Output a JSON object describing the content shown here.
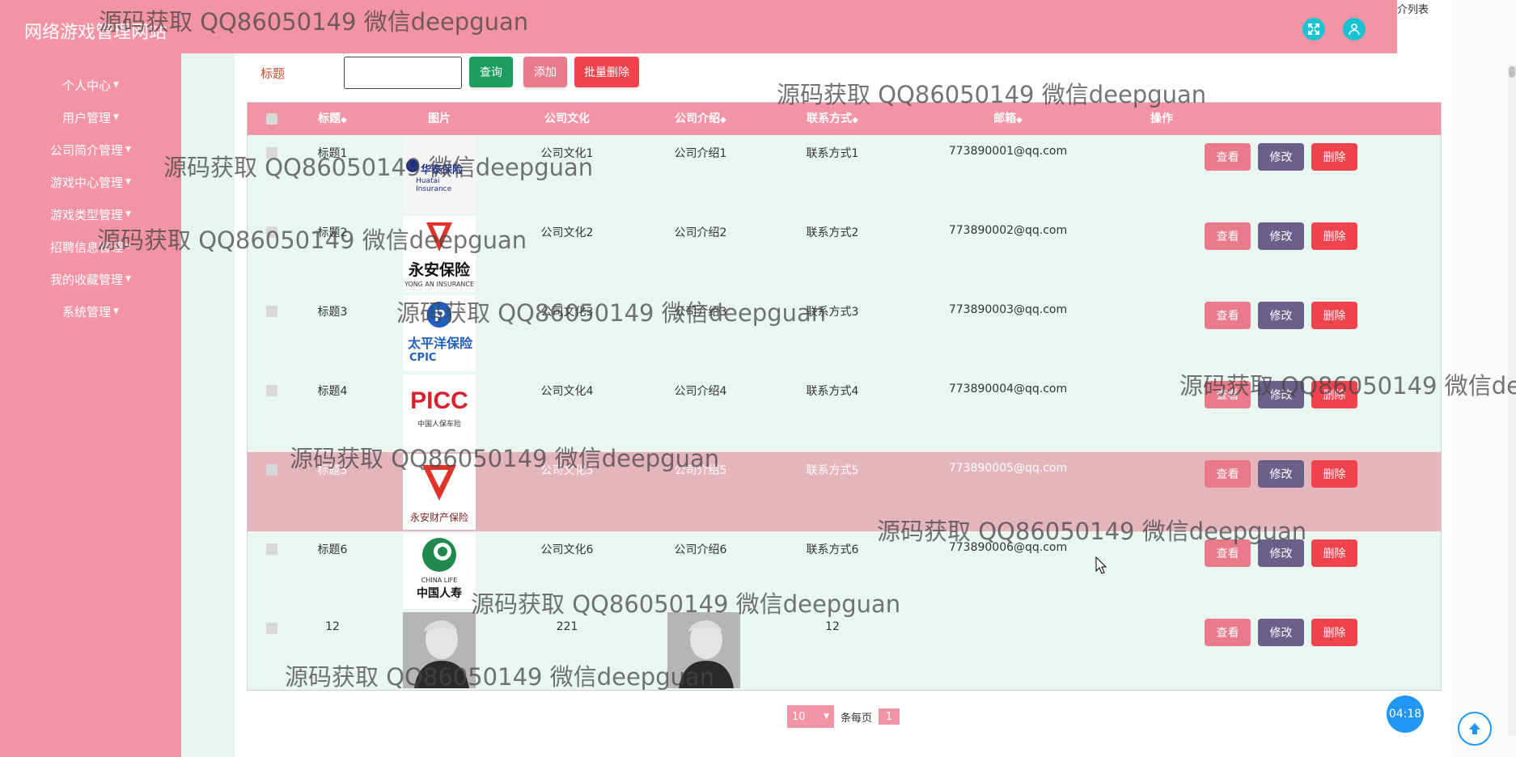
{
  "header": {
    "site_title": "网络游戏管理网站",
    "tab_label": "介列表"
  },
  "sidebar": {
    "items": [
      {
        "label": "个人中心"
      },
      {
        "label": "用户管理"
      },
      {
        "label": "公司简介管理"
      },
      {
        "label": "游戏中心管理"
      },
      {
        "label": "游戏类型管理"
      },
      {
        "label": "招聘信息管理"
      },
      {
        "label": "我的收藏管理"
      },
      {
        "label": "系统管理"
      }
    ]
  },
  "search": {
    "label": "标题",
    "value": "",
    "query_btn": "查询",
    "add_btn": "添加",
    "batch_delete_btn": "批量删除"
  },
  "table": {
    "headers": {
      "title": "标题",
      "image": "图片",
      "culture": "公司文化",
      "intro": "公司介绍",
      "contact": "联系方式",
      "email": "邮箱",
      "actions": "操作"
    },
    "sort_icon": "◆",
    "rows": [
      {
        "title": "标题1",
        "culture": "公司文化1",
        "intro": "公司介绍1",
        "contact": "联系方式1",
        "email": "773890001@qq.com",
        "logo": "华泰保险"
      },
      {
        "title": "标题2",
        "culture": "公司文化2",
        "intro": "公司介绍2",
        "contact": "联系方式2",
        "email": "773890002@qq.com",
        "logo": "永安保险"
      },
      {
        "title": "标题3",
        "culture": "公司文化3",
        "intro": "公司介绍3",
        "contact": "联系方式3",
        "email": "773890003@qq.com",
        "logo": "太平洋保险"
      },
      {
        "title": "标题4",
        "culture": "公司文化4",
        "intro": "公司介绍4",
        "contact": "联系方式4",
        "email": "773890004@qq.com",
        "logo": "PICC"
      },
      {
        "title": "标题5",
        "culture": "公司文化5",
        "intro": "公司介绍5",
        "contact": "联系方式5",
        "email": "773890005@qq.com",
        "logo": "永安财产保险"
      },
      {
        "title": "标题6",
        "culture": "公司文化6",
        "intro": "公司介绍6",
        "contact": "联系方式6",
        "email": "773890006@qq.com",
        "logo": "中国人寿"
      },
      {
        "title": "12",
        "culture": "221",
        "intro": "",
        "contact": "12",
        "email": "",
        "logo": ""
      }
    ],
    "actions": {
      "view": "查看",
      "edit": "修改",
      "delete": "删除"
    }
  },
  "logo_text": {
    "huatai": "华泰保险",
    "huatai_en": "Huatai Insurance",
    "yongan": "永安保险",
    "yongan_en": "YONG AN INSURANCE",
    "cpic_cn": "太平洋保险",
    "cpic_en": "CPIC",
    "picc": "PICC",
    "picc_cn": "中国人保车险",
    "yongan_prop": "永安财产保险",
    "chinalife_en": "CHINA LIFE",
    "chinalife_cn": "中国人寿"
  },
  "pagination": {
    "page_size": "10",
    "per_page_label": "条每页",
    "current_page": "1"
  },
  "timer": "04:18",
  "watermark": "源码获取 QQ86050149 微信deepguan",
  "colors": {
    "primary_pink": "#f394a5",
    "row_bg": "#eaf6f0",
    "highlight_row": "#e5b5bd",
    "query_green": "#1a9d5e",
    "view_btn": "#e97a8b",
    "edit_btn": "#6c5f8a",
    "delete_btn": "#f1434e",
    "timer_blue": "#2196f3"
  }
}
